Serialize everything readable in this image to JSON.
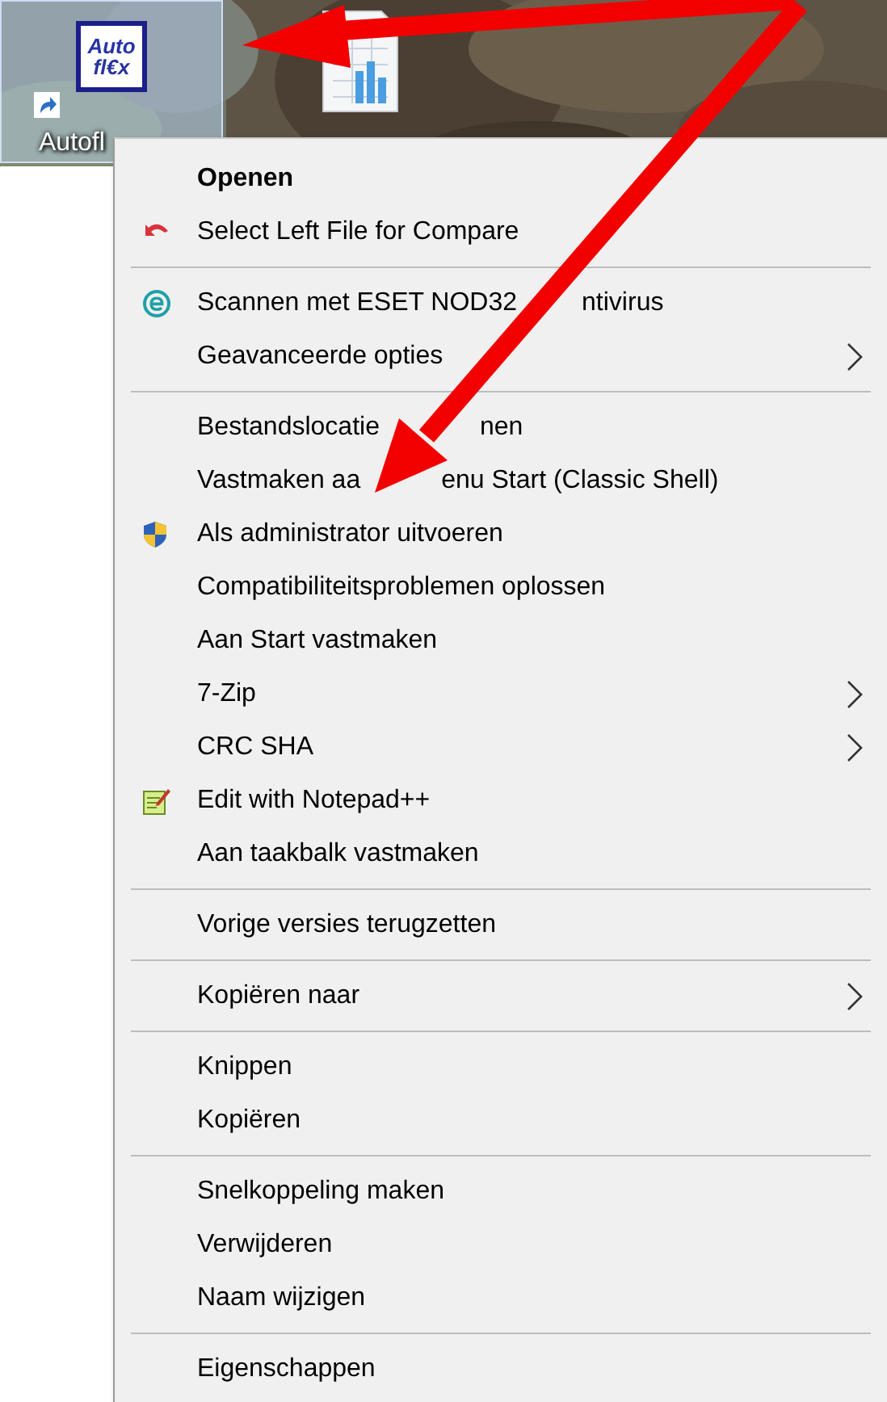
{
  "desktop": {
    "icons": [
      {
        "label": "Autofl",
        "logo_text": [
          "Auto",
          "fl€x"
        ],
        "shortcut": true,
        "selected": true
      },
      {
        "kind": "spreadsheet",
        "selected": false
      }
    ]
  },
  "context_menu": {
    "groups": [
      {
        "items": [
          {
            "label": "Openen",
            "default": true,
            "submenu": false
          },
          {
            "label": "Select Left File for Compare",
            "default": false,
            "submenu": false
          }
        ]
      },
      {
        "items": [
          {
            "label": "Scannen met ESET NOD32",
            "label_tail": "ntivirus",
            "default": false,
            "submenu": false
          },
          {
            "label": "Geavanceerde opties",
            "default": false,
            "submenu": true
          }
        ]
      },
      {
        "items": [
          {
            "label": "Bestandslocatie",
            "label_tail": "nen",
            "default": false,
            "submenu": false
          },
          {
            "label": "Vastmaken aa",
            "label_tail": "enu Start (Classic Shell)",
            "default": false,
            "submenu": false
          },
          {
            "label": "Als administrator uitvoeren",
            "default": false,
            "submenu": false
          },
          {
            "label": "Compatibiliteitsproblemen oplossen",
            "default": false,
            "submenu": false
          },
          {
            "label": "Aan Start vastmaken",
            "default": false,
            "submenu": false
          },
          {
            "label": "7-Zip",
            "default": false,
            "submenu": true
          },
          {
            "label": "CRC SHA",
            "default": false,
            "submenu": true
          },
          {
            "label": "Edit with Notepad++",
            "default": false,
            "submenu": false
          },
          {
            "label": "Aan taakbalk vastmaken",
            "default": false,
            "submenu": false
          }
        ]
      },
      {
        "items": [
          {
            "label": "Vorige versies terugzetten",
            "default": false,
            "submenu": false
          }
        ]
      },
      {
        "items": [
          {
            "label": "Kopiëren naar",
            "default": false,
            "submenu": true
          }
        ]
      },
      {
        "items": [
          {
            "label": "Knippen",
            "default": false,
            "submenu": false
          },
          {
            "label": "Kopiëren",
            "default": false,
            "submenu": false
          }
        ]
      },
      {
        "items": [
          {
            "label": "Snelkoppeling maken",
            "default": false,
            "submenu": false
          },
          {
            "label": "Verwijderen",
            "default": false,
            "submenu": false
          },
          {
            "label": "Naam wijzigen",
            "default": false,
            "submenu": false
          }
        ]
      },
      {
        "items": [
          {
            "label": "Eigenschappen",
            "default": false,
            "submenu": false
          }
        ]
      }
    ]
  }
}
